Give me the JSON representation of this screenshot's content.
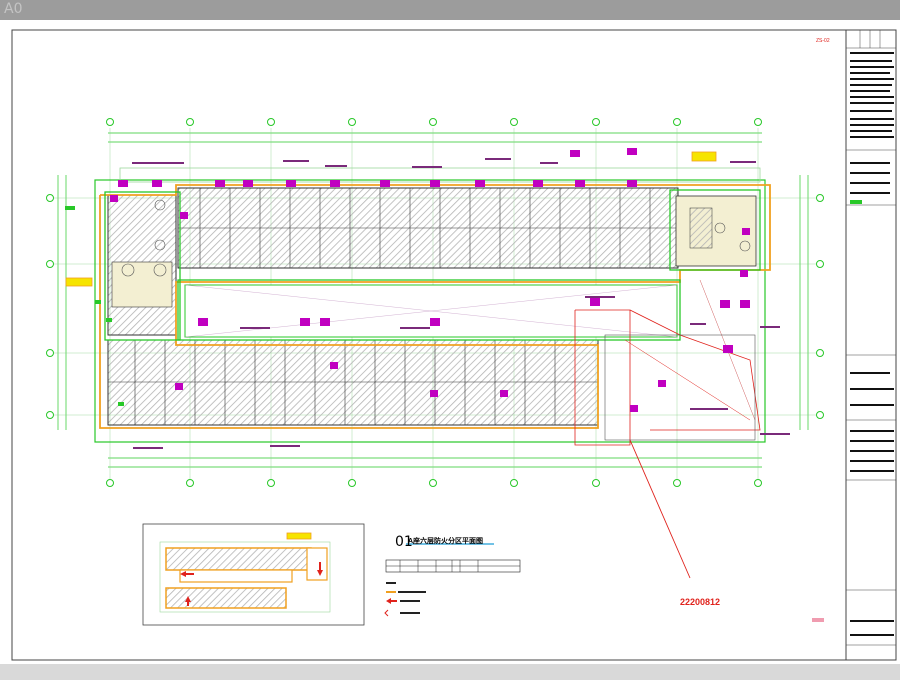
{
  "window": {
    "corner_label": "A0"
  },
  "drawing": {
    "revision_stamp": "22200812",
    "plan_number": "01",
    "plan_title": "A座六层防火分区平面图",
    "sheet_code": "ZS-02"
  },
  "colors": {
    "outline_green": "#28c828",
    "fire_zone_orange": "#f0a020",
    "revision_red": "#e0221c",
    "label_magenta": "#c000c0",
    "hatch_gray": "#b4b4b4",
    "wall_dark": "#323232",
    "label_purple": "#7a2a7a"
  },
  "icons": {
    "axis_marker": "green-circle-axis-icon",
    "exit_arrow": "red-exit-arrow-icon"
  }
}
